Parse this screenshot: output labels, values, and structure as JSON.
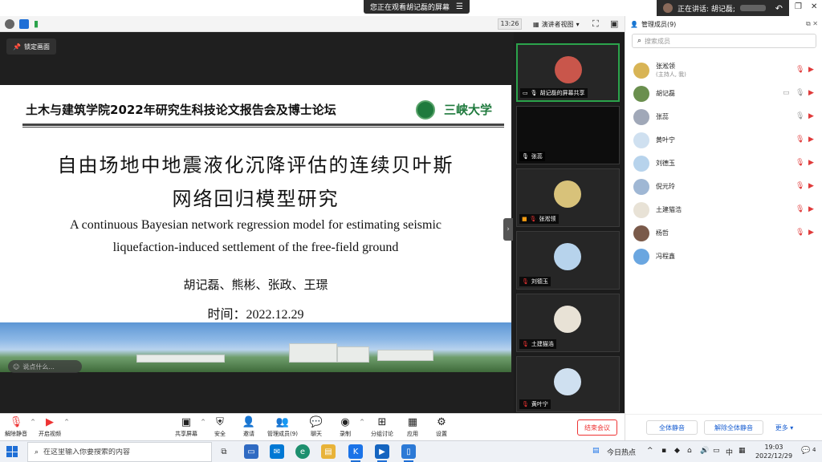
{
  "banner": {
    "watching": "您正在观看胡记磊的屏幕",
    "speaking": "正在讲话: 胡记磊;"
  },
  "top_bar": {
    "clock": "13:26",
    "view": "演讲者视图"
  },
  "stage": {
    "lock_label": "锁定画面",
    "comment_placeholder": "说点什么...",
    "slide": {
      "header_title": "土木与建筑学院2022年研究生科技论文报告会及博士论坛",
      "logo_text": "三峡大学",
      "cn_title_line1": "自由场地中地震液化沉降评估的连续贝叶斯",
      "cn_title_line2": "网络回归模型研究",
      "en_title_line1": "A continuous Bayesian network regression model for estimating seismic",
      "en_title_line2": "liquefaction-induced settlement of the free-field ground",
      "authors": "胡记磊、熊彬、张政、王璟",
      "date": "时间：2022.12.29"
    }
  },
  "gallery": [
    {
      "name": "胡记磊的屏幕共享",
      "avatar_color": "#c9564b",
      "active": true
    },
    {
      "name": "张蕊",
      "avatar_color": null,
      "active": false
    },
    {
      "name": "张淞领",
      "avatar_color": "#d8c27a",
      "active": false
    },
    {
      "name": "刘德玉",
      "avatar_color": "#b7d3ec",
      "active": false
    },
    {
      "name": "土建猫浩",
      "avatar_color": "#e8e2d6",
      "active": false
    },
    {
      "name": "黄叶宁",
      "avatar_color": "#cfe0f0",
      "active": false
    }
  ],
  "panel": {
    "title": "管理成员(9)",
    "search_placeholder": "搜索成员",
    "members": [
      {
        "name": "张淞领",
        "sub": "(主持人, 我)",
        "avatar_color": "#d8b455"
      },
      {
        "name": "胡记磊",
        "sub": "",
        "avatar_color": "#6a8f4e"
      },
      {
        "name": "张蕊",
        "sub": "",
        "avatar_color": "#a0a8b8"
      },
      {
        "name": "黄叶宁",
        "sub": "",
        "avatar_color": "#cfe0f0"
      },
      {
        "name": "刘德玉",
        "sub": "",
        "avatar_color": "#b7d3ec"
      },
      {
        "name": "倪元玲",
        "sub": "",
        "avatar_color": "#9fb7d4"
      },
      {
        "name": "土建猫浩",
        "sub": "",
        "avatar_color": "#e8e2d6"
      },
      {
        "name": "杨哲",
        "sub": "",
        "avatar_color": "#7a5a4a"
      },
      {
        "name": "冯程鑫",
        "sub": "",
        "avatar_color": "#6aa6e0"
      }
    ],
    "mute_all": "全体静音",
    "unmute_all": "解除全体静音",
    "more": "更多 ▾"
  },
  "controls": {
    "unmute": "解除静音",
    "start_video": "开启视频",
    "share_screen": "共享屏幕",
    "security": "安全",
    "invite": "邀请",
    "participants": "管理成员(9)",
    "chat": "聊天",
    "record": "录制",
    "breakout": "分组讨论",
    "apps": "应用",
    "settings": "设置",
    "end_meeting": "结束会议"
  },
  "taskbar": {
    "search_placeholder": "在这里输入你要搜索的内容",
    "news": "今日热点",
    "ime": "中",
    "time": "19:03",
    "date": "2022/12/29",
    "notification_count": "4"
  },
  "colors": {
    "accent": "#1a5fd1",
    "danger": "#e33333",
    "active_speaker": "#2ba34b"
  }
}
